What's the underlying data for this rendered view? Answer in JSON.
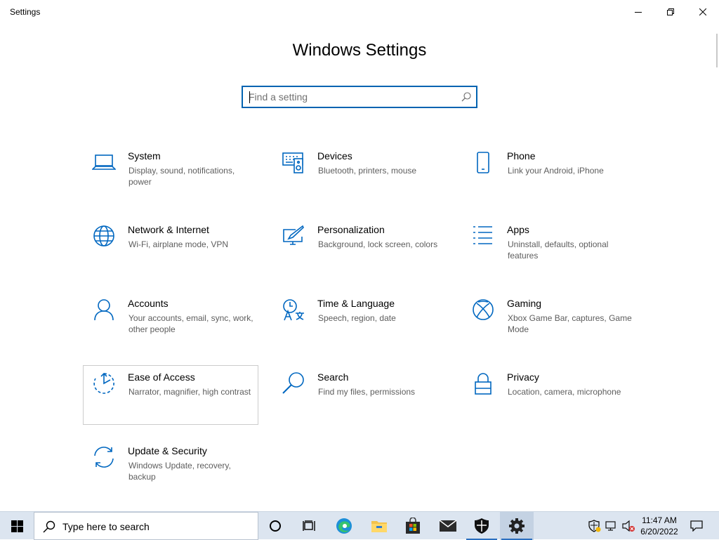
{
  "window": {
    "title": "Settings",
    "controls": [
      "minimize",
      "restore",
      "close"
    ]
  },
  "page": {
    "heading": "Windows Settings",
    "search": {
      "value": "",
      "placeholder": "Find a setting",
      "icon": "search-icon"
    }
  },
  "tiles": [
    {
      "name": "System",
      "desc": "Display, sound, notifications, power",
      "icon": "laptop-icon"
    },
    {
      "name": "Devices",
      "desc": "Bluetooth, printers, mouse",
      "icon": "keyboard-speaker-icon"
    },
    {
      "name": "Phone",
      "desc": "Link your Android, iPhone",
      "icon": "phone-icon"
    },
    {
      "name": "Network & Internet",
      "desc": "Wi-Fi, airplane mode, VPN",
      "icon": "globe-icon"
    },
    {
      "name": "Personalization",
      "desc": "Background, lock screen, colors",
      "icon": "paint-monitor-icon"
    },
    {
      "name": "Apps",
      "desc": "Uninstall, defaults, optional features",
      "icon": "apps-list-icon"
    },
    {
      "name": "Accounts",
      "desc": "Your accounts, email, sync, work, other people",
      "icon": "person-icon"
    },
    {
      "name": "Time & Language",
      "desc": "Speech, region, date",
      "icon": "time-language-icon"
    },
    {
      "name": "Gaming",
      "desc": "Xbox Game Bar, captures, Game Mode",
      "icon": "xbox-icon"
    },
    {
      "name": "Ease of Access",
      "desc": "Narrator, magnifier, high contrast",
      "icon": "ease-of-access-icon"
    },
    {
      "name": "Search",
      "desc": "Find my files, permissions",
      "icon": "magnifier-icon"
    },
    {
      "name": "Privacy",
      "desc": "Location, camera, microphone",
      "icon": "lock-icon"
    },
    {
      "name": "Update & Security",
      "desc": "Windows Update, recovery, backup",
      "icon": "sync-arrows-icon"
    }
  ],
  "taskbar": {
    "search_text": "Type here to search",
    "apps": [
      "cortana-icon",
      "task-view-icon",
      "edge-icon",
      "file-explorer-icon",
      "store-icon",
      "mail-icon",
      "security-shield-icon",
      "settings-gear-icon"
    ],
    "tray": [
      "security-tray-icon",
      "network-icon",
      "volume-muted-icon"
    ],
    "time": "11:47 AM",
    "date": "6/20/2022",
    "notification_icon": "action-center-icon"
  },
  "colors": {
    "accent": "#0063b1",
    "icon_blue": "#0067c0",
    "taskbar": "#dce5f0"
  }
}
